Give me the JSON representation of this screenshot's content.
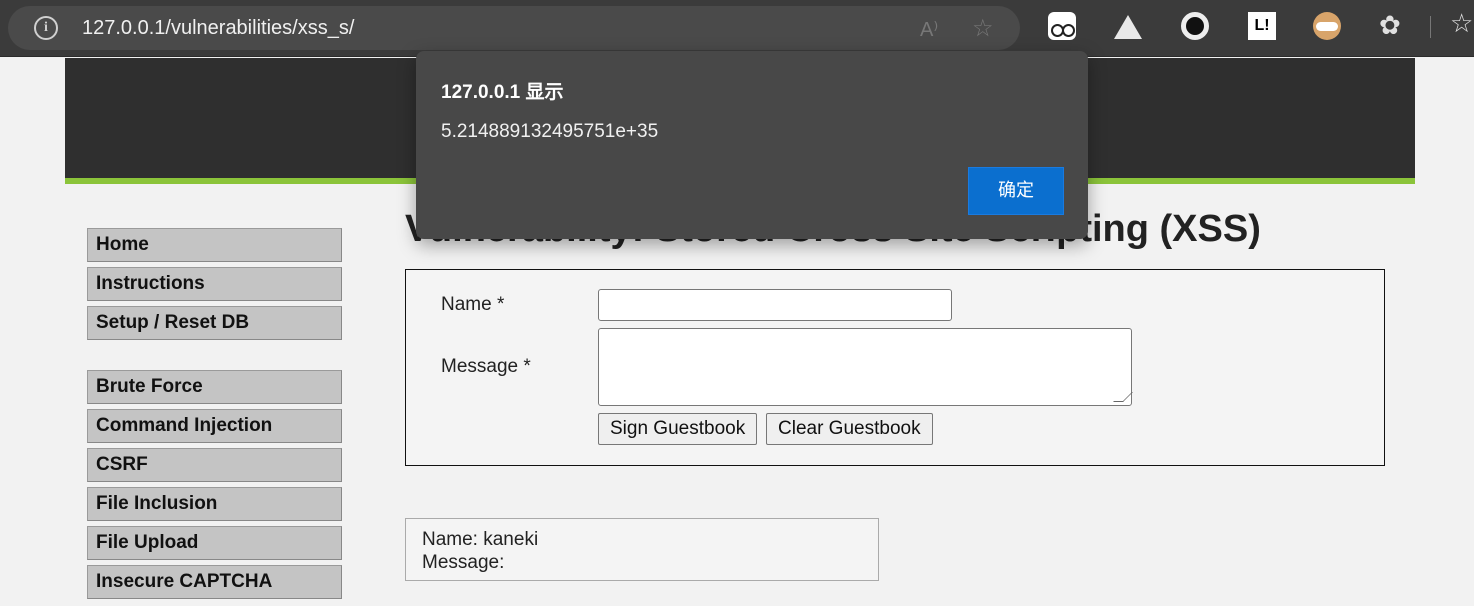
{
  "browser": {
    "url": "127.0.0.1/vulnerabilities/xss_s/",
    "read_aloud_glyph": "A⁾",
    "extensions": [
      "glasses-extension-icon",
      "triangle-extension-icon",
      "circle-extension-icon",
      "l-extension-icon",
      "owl-extension-icon",
      "puzzle-extensions-icon"
    ],
    "ext4_label": "L!"
  },
  "page": {
    "title": "Vulnerability: Stored Cross Site Scripting (XSS)",
    "menu_group1": [
      "Home",
      "Instructions",
      "Setup / Reset DB"
    ],
    "menu_group2": [
      "Brute Force",
      "Command Injection",
      "CSRF",
      "File Inclusion",
      "File Upload",
      "Insecure CAPTCHA"
    ],
    "form": {
      "name_label": "Name *",
      "message_label": "Message *",
      "name_value": "",
      "message_value": "",
      "sign_button": "Sign Guestbook",
      "clear_button": "Clear Guestbook"
    },
    "entry": {
      "name_line": "Name: kaneki",
      "message_line": "Message:"
    }
  },
  "dialog": {
    "title": "127.0.0.1 显示",
    "message": "5.214889132495751e+35",
    "ok_button": "确定"
  },
  "colors": {
    "accent_green": "#8bc43a",
    "header_dark": "#2f2f2f",
    "dialog_button_blue": "#0b6fcf"
  }
}
